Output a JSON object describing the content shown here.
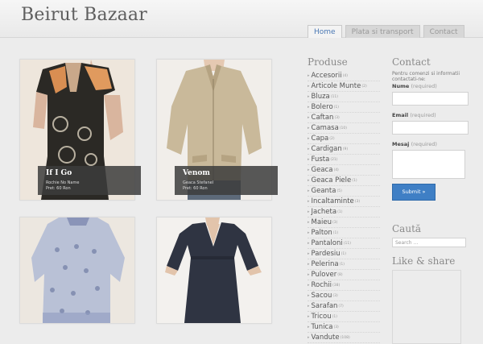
{
  "site": {
    "title": "Beirut Bazaar"
  },
  "nav": {
    "tabs": [
      {
        "label": "Home",
        "active": true
      },
      {
        "label": "Plata si transport",
        "active": false
      },
      {
        "label": "Contact",
        "active": false
      }
    ]
  },
  "products": [
    {
      "title": "If I Go",
      "subtitle": "Rochie No Name",
      "price": "Pret: 60 Ron"
    },
    {
      "title": "Venom",
      "subtitle": "Geaca Stefanel",
      "price": "Pret: 60 Ron"
    },
    {
      "title": "",
      "subtitle": "",
      "price": ""
    },
    {
      "title": "",
      "subtitle": "",
      "price": ""
    }
  ],
  "sidebar": {
    "products_title": "Produse",
    "categories": [
      {
        "name": "Accesorii",
        "count": "(4)"
      },
      {
        "name": "Articole Munte",
        "count": "(2)"
      },
      {
        "name": "Bluza",
        "count": "(11)"
      },
      {
        "name": "Bolero",
        "count": "(1)"
      },
      {
        "name": "Caftan",
        "count": "(3)"
      },
      {
        "name": "Camasa",
        "count": "(10)"
      },
      {
        "name": "Capa",
        "count": "(2)"
      },
      {
        "name": "Cardigan",
        "count": "(9)"
      },
      {
        "name": "Fusta",
        "count": "(21)"
      },
      {
        "name": "Geaca",
        "count": "(4)"
      },
      {
        "name": "Geaca Piele",
        "count": "(1)"
      },
      {
        "name": "Geanta",
        "count": "(5)"
      },
      {
        "name": "Incaltaminte",
        "count": "(3)"
      },
      {
        "name": "Jacheta",
        "count": "(1)"
      },
      {
        "name": "Maieu",
        "count": "(3)"
      },
      {
        "name": "Palton",
        "count": "(1)"
      },
      {
        "name": "Pantaloni",
        "count": "(11)"
      },
      {
        "name": "Pardesiu",
        "count": "(1)"
      },
      {
        "name": "Pelerina",
        "count": "(1)"
      },
      {
        "name": "Pulover",
        "count": "(8)"
      },
      {
        "name": "Rochii",
        "count": "(38)"
      },
      {
        "name": "Sacou",
        "count": "(3)"
      },
      {
        "name": "Sarafan",
        "count": "(7)"
      },
      {
        "name": "Tricou",
        "count": "(1)"
      },
      {
        "name": "Tunica",
        "count": "(3)"
      },
      {
        "name": "Vandute",
        "count": "(108)"
      }
    ],
    "contact": {
      "title": "Contact",
      "intro": "Pentru comenzi si informatii contactati-ne:",
      "name_label": "Nume",
      "email_label": "Email",
      "message_label": "Mesaj",
      "required": "(required)",
      "submit": "Submit »"
    },
    "search": {
      "title": "Caută",
      "placeholder": "Search ..."
    },
    "like": {
      "title": "Like & share"
    }
  },
  "colors": {
    "accent": "#3f7fc5",
    "nav_active": "#4a78b4",
    "background": "#ececec"
  }
}
